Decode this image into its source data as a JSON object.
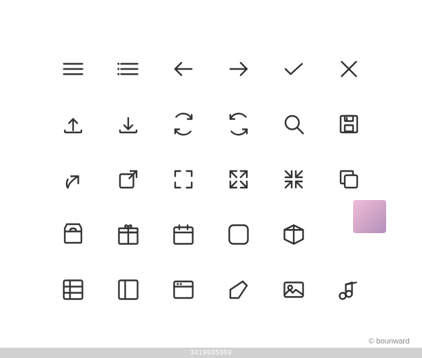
{
  "watermark": {
    "text": "© bounward",
    "getty_text": "3419935369"
  },
  "icons": [
    {
      "id": "hamburger-menu",
      "row": 1,
      "col": 1
    },
    {
      "id": "list-menu",
      "row": 1,
      "col": 2
    },
    {
      "id": "arrow-left",
      "row": 1,
      "col": 3
    },
    {
      "id": "arrow-right",
      "row": 1,
      "col": 4
    },
    {
      "id": "checkmark",
      "row": 1,
      "col": 5
    },
    {
      "id": "close-x",
      "row": 1,
      "col": 6
    },
    {
      "id": "upload",
      "row": 2,
      "col": 1
    },
    {
      "id": "download",
      "row": 2,
      "col": 2
    },
    {
      "id": "refresh-cw",
      "row": 2,
      "col": 3
    },
    {
      "id": "refresh-ccw",
      "row": 2,
      "col": 4
    },
    {
      "id": "search",
      "row": 2,
      "col": 5
    },
    {
      "id": "save-floppy",
      "row": 2,
      "col": 6
    },
    {
      "id": "share-forward",
      "row": 3,
      "col": 1
    },
    {
      "id": "external-link",
      "row": 3,
      "col": 2
    },
    {
      "id": "frame-select",
      "row": 3,
      "col": 3
    },
    {
      "id": "expand",
      "row": 3,
      "col": 4
    },
    {
      "id": "compress",
      "row": 3,
      "col": 5
    },
    {
      "id": "copy-layer",
      "row": 3,
      "col": 6
    },
    {
      "id": "shopping-bag",
      "row": 4,
      "col": 1
    },
    {
      "id": "gift",
      "row": 4,
      "col": 2
    },
    {
      "id": "calendar",
      "row": 4,
      "col": 3
    },
    {
      "id": "rounded-square",
      "row": 4,
      "col": 4
    },
    {
      "id": "3d-box",
      "row": 4,
      "col": 5
    },
    {
      "id": "placeholder6",
      "row": 4,
      "col": 6
    },
    {
      "id": "table-grid",
      "row": 5,
      "col": 1
    },
    {
      "id": "panel-layout",
      "row": 5,
      "col": 2
    },
    {
      "id": "browser-window",
      "row": 5,
      "col": 3
    },
    {
      "id": "edit-pencil",
      "row": 5,
      "col": 4
    },
    {
      "id": "image-photo",
      "row": 5,
      "col": 5
    },
    {
      "id": "music-note",
      "row": 5,
      "col": 6
    }
  ]
}
